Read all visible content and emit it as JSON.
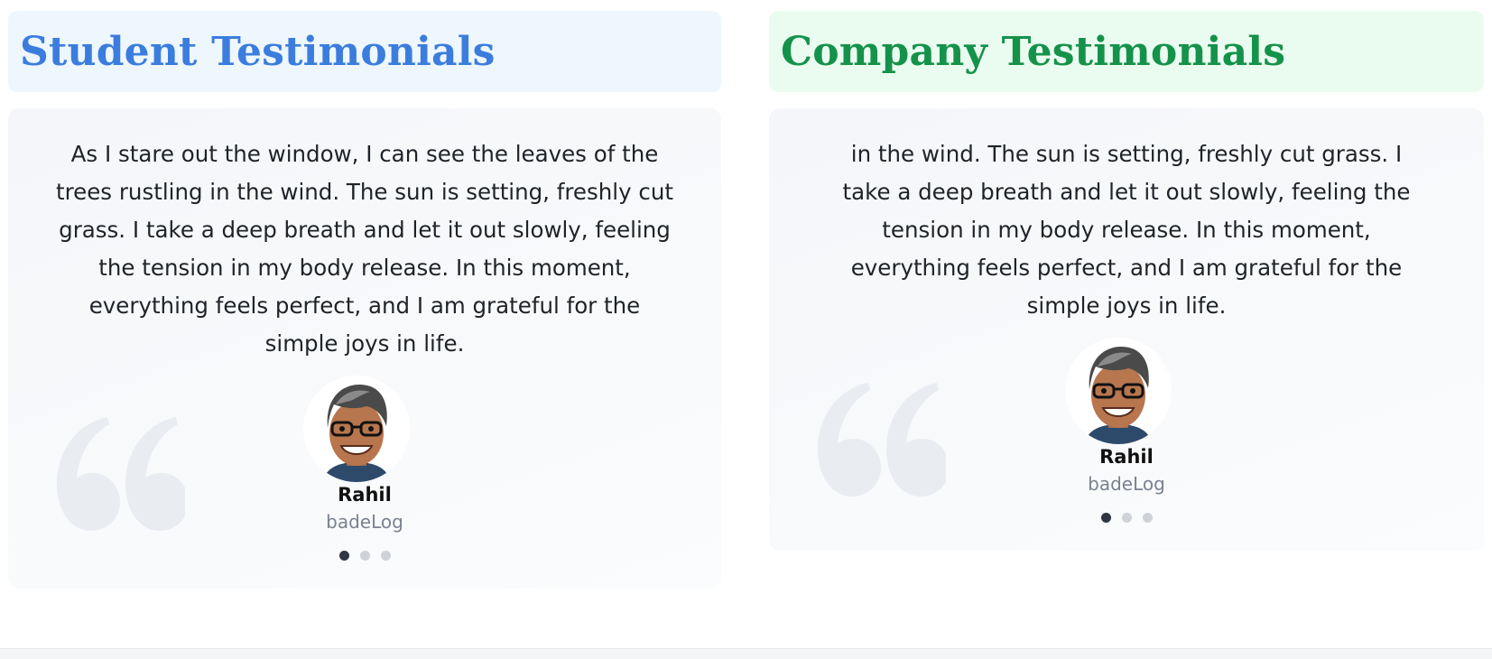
{
  "student": {
    "title": "Student Testimonials",
    "quote": "As I stare out the window, I can see the leaves of the trees rustling in the wind. The sun is setting, freshly cut grass. I take a deep breath and let it out slowly, feeling the tension in my body release. In this moment, everything feels perfect, and I am grateful for the simple joys in life.",
    "name": "Rahil",
    "company": "badeLog",
    "active_slide": 1,
    "slide_count": 3
  },
  "company": {
    "title": "Company Testimonials",
    "quote": "in the wind. The sun is setting, freshly cut grass. I take a deep breath and let it out slowly, feeling the tension in my body release. In this moment, everything feels perfect, and I am grateful for the simple joys in life.",
    "name": "Rahil",
    "company": "badeLog",
    "active_slide": 1,
    "slide_count": 3
  },
  "colors": {
    "student_accent": "#3b7ddd",
    "student_bg": "#eef6fe",
    "company_accent": "#15924a",
    "company_bg": "#eafcf0",
    "dot_active": "#2f3744",
    "dot_inactive": "#cfd2d6"
  },
  "icons": {
    "quote": "quote-icon",
    "avatar": "avatar-icon"
  }
}
